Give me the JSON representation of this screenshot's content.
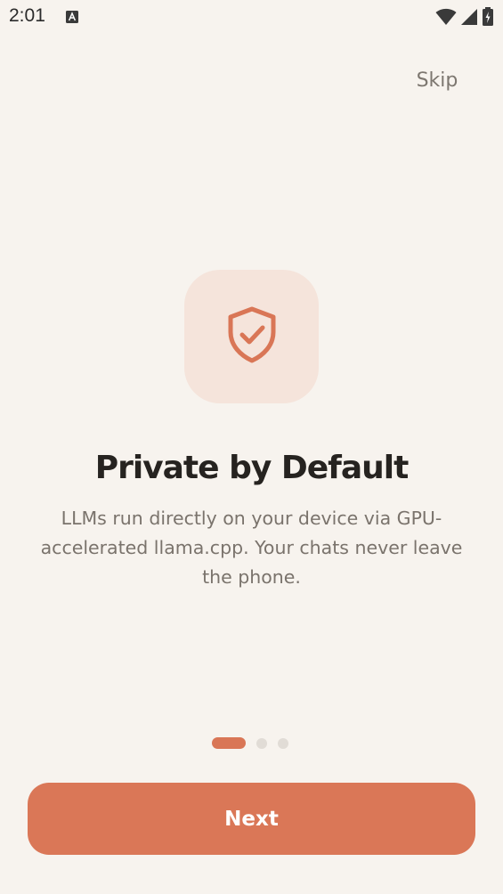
{
  "status_bar": {
    "time": "2:01",
    "icons": [
      "a-notification-icon",
      "wifi-icon",
      "signal-icon",
      "battery-charging-icon"
    ]
  },
  "onboarding": {
    "skip_label": "Skip",
    "icon": "shield-check-icon",
    "title": "Private by Default",
    "description": "LLMs run directly on your device via GPU-accelerated llama.cpp. Your chats never leave the phone.",
    "page_indicator": {
      "current": 1,
      "total": 3
    },
    "next_label": "Next"
  },
  "colors": {
    "background": "#f7f3ee",
    "accent": "#da7757",
    "icon_tile": "#f5e4db",
    "title": "#262320",
    "body_text": "#7a736c",
    "inactive_dot": "#e1dcd6"
  }
}
